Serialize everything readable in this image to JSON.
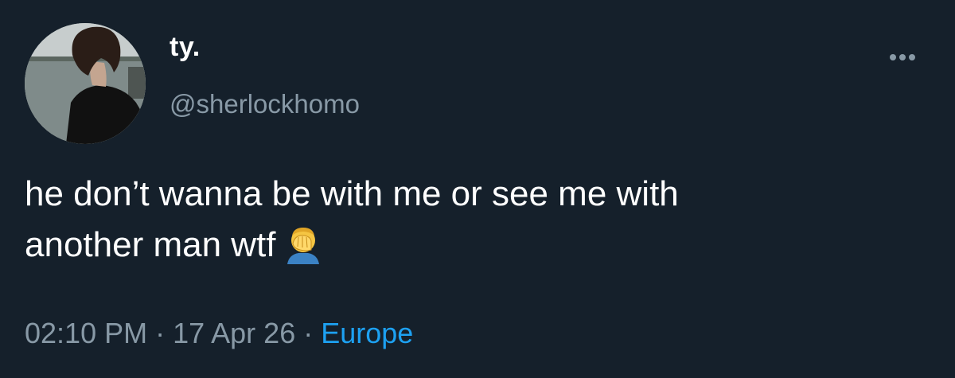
{
  "tweet": {
    "avatar_icon": "profile-photo",
    "display_name": "ty.",
    "handle": "@sherlockhomo",
    "more_icon": "more-horizontal-icon",
    "text_line1": "he don’t wanna be with me or see me with",
    "text_line2": "another man wtf",
    "emoji": "man-facepalming-emoji",
    "time": "02:10 PM",
    "separator": "·",
    "date": "17 Apr 26",
    "location": "Europe"
  },
  "colors": {
    "background": "#15202b",
    "primary_text": "#ffffff",
    "secondary_text": "#8899a6",
    "link": "#1da1f2"
  }
}
